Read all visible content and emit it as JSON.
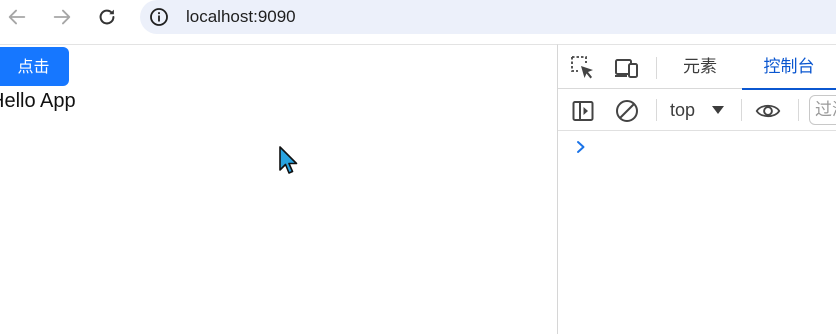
{
  "browser": {
    "back_icon": "arrow-left-icon",
    "forward_icon": "arrow-right-icon",
    "reload_icon": "reload-icon",
    "site_info_icon": "info-icon",
    "url": "localhost:9090",
    "omnibox_color": "#ecf0fa"
  },
  "page": {
    "button_label": "点击",
    "button_color": "#1677ff",
    "hello_text": "Hello App",
    "cursor_icon": "mouse-pointer-icon"
  },
  "devtools": {
    "tabs": [
      {
        "label": "元素",
        "active": false
      },
      {
        "label": "控制台",
        "active": true
      }
    ],
    "accent_color": "#0b57d0",
    "console": {
      "context": "top",
      "filter_placeholder": "过滤"
    },
    "prompt_icon": "chevron-right-icon"
  }
}
